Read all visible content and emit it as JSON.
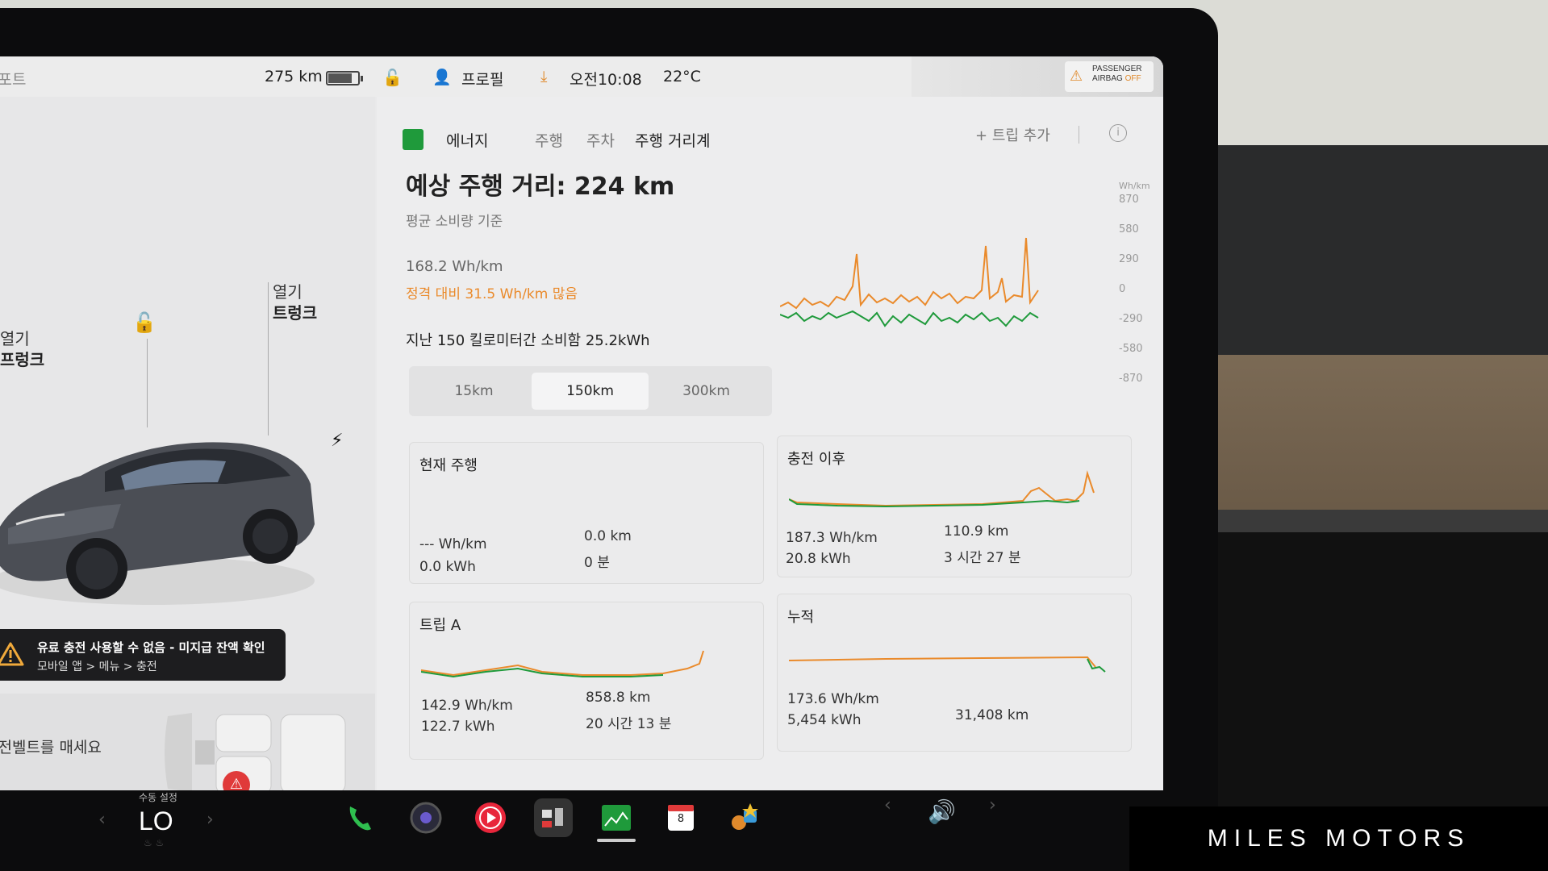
{
  "status_bar": {
    "left_clip": "컴포트",
    "range": "275 km",
    "battery_percent": 80,
    "profile": "프로필",
    "time": "오전10:08",
    "temperature": "22°C",
    "airbag_line1": "PASSENGER",
    "airbag_line2": "AIRBAG",
    "airbag_state": "OFF"
  },
  "car": {
    "trunk_open": "열기",
    "trunk_label": "트렁크",
    "frunk_open": "열기",
    "frunk_label": "프렁크",
    "alert_title": "유료 충전 사용할 수 없음 - 미지급 잔액 확인",
    "alert_sub": "모바일 앱 > 메뉴 > 충전",
    "seatbelt_msg": "안전벨트를 매세요"
  },
  "energy": {
    "tabs": [
      "에너지",
      "주행",
      "주차",
      "주행 거리계"
    ],
    "add_trip": "트립 추가",
    "info_icon": "i",
    "estimated_range": "예상 주행 거리: 224 km",
    "basis": "평균 소비량 기준",
    "avg_rate": "168.2 Wh/km",
    "vs_rated": "정격 대비 31.5 Wh/km 많음",
    "consumed": "지난 150 킬로미터간 소비함 25.2kWh",
    "segments": [
      "15km",
      "150km",
      "300km"
    ],
    "selected_segment": "150km",
    "y_unit": "Wh/km",
    "y_ticks": [
      "870",
      "580",
      "290",
      "0",
      "-290",
      "-580",
      "-870"
    ]
  },
  "cards": {
    "current": {
      "title": "현재 주행",
      "rate": "--- Wh/km",
      "energy": "0.0 kWh",
      "distance": "0.0 km",
      "duration": "0 분"
    },
    "since_charge": {
      "title": "충전 이후",
      "rate": "187.3 Wh/km",
      "energy": "20.8 kWh",
      "distance": "110.9 km",
      "duration": "3 시간 27 분"
    },
    "trip_a": {
      "title": "트립 A",
      "rate": "142.9 Wh/km",
      "energy": "122.7 kWh",
      "distance": "858.8 km",
      "duration": "20 시간 13 분"
    },
    "lifetime": {
      "title": "누적",
      "rate": "173.6 Wh/km",
      "energy": "5,454 kWh",
      "distance": "31,408 km"
    }
  },
  "dock": {
    "climate_label": "수동 설정",
    "climate_value": "LO",
    "calendar_day": "8"
  },
  "watermark": "MILES MOTORS",
  "colors": {
    "accent_green": "#1f9a3b",
    "accent_orange": "#ea8a2b",
    "alert_bg": "#1d1d1f"
  }
}
